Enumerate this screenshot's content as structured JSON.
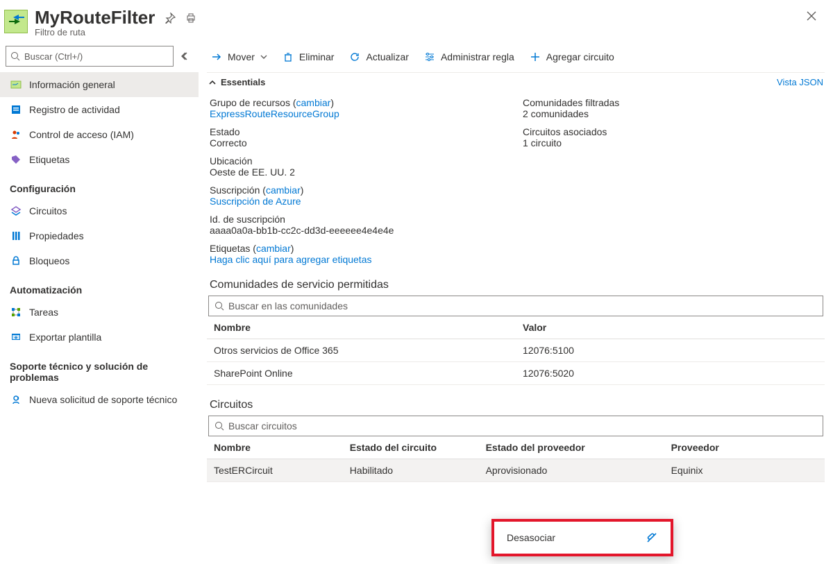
{
  "header": {
    "title": "MyRouteFilter",
    "subtitle": "Filtro de ruta"
  },
  "sidebar": {
    "search_placeholder": "Buscar (Ctrl+/)",
    "sections": {
      "top": [
        {
          "label": "Información general",
          "icon": "routefilter",
          "selected": true
        },
        {
          "label": "Registro de actividad",
          "icon": "activity"
        },
        {
          "label": "Control de acceso (IAM)",
          "icon": "iam"
        },
        {
          "label": "Etiquetas",
          "icon": "tag"
        }
      ],
      "config_title": "Configuración",
      "config": [
        {
          "label": "Circuitos",
          "icon": "circuits"
        },
        {
          "label": "Propiedades",
          "icon": "properties"
        },
        {
          "label": "Bloqueos",
          "icon": "lock"
        }
      ],
      "auto_title": "Automatización",
      "auto": [
        {
          "label": "Tareas",
          "icon": "tasks"
        },
        {
          "label": "Exportar plantilla",
          "icon": "export"
        }
      ],
      "support_title": "Soporte técnico y solución de problemas",
      "support": [
        {
          "label": "Nueva solicitud de soporte técnico",
          "icon": "support"
        }
      ]
    }
  },
  "toolbar": {
    "move": "Mover",
    "delete": "Eliminar",
    "refresh": "Actualizar",
    "manage_rule": "Administrar regla",
    "add_circuit": "Agregar circuito"
  },
  "essentials": {
    "toggle_label": "Essentials",
    "json_view": "Vista JSON",
    "rg_label": "Grupo de recursos",
    "change": "cambiar",
    "rg_value": "ExpressRouteResourceGroup",
    "state_label": "Estado",
    "state_value": "Correcto",
    "location_label": "Ubicación",
    "location_value": "Oeste de EE. UU. 2",
    "sub_label": "Suscripción",
    "sub_value": "Suscripción de Azure",
    "subid_label": "Id. de suscripción",
    "subid_value": "aaaa0a0a-bb1b-cc2c-dd3d-eeeeee4e4e4e",
    "tags_label": "Etiquetas",
    "tags_value": "Haga clic aquí para agregar etiquetas",
    "communities_label": "Comunidades filtradas",
    "communities_value": "2 comunidades",
    "circuits_label": "Circuitos asociados",
    "circuits_value": "1 circuito"
  },
  "communities": {
    "title": "Comunidades de servicio permitidas",
    "search_placeholder": "Buscar en las comunidades",
    "col_name": "Nombre",
    "col_value": "Valor",
    "rows": [
      {
        "name": "Otros servicios de Office 365",
        "value": "12076:5100"
      },
      {
        "name": "SharePoint Online",
        "value": "12076:5020"
      }
    ]
  },
  "circuits": {
    "title": "Circuitos",
    "search_placeholder": "Buscar circuitos",
    "col_name": "Nombre",
    "col_circuit_state": "Estado del circuito",
    "col_provider_state": "Estado del proveedor",
    "col_provider": "Proveedor",
    "rows": [
      {
        "name": "TestERCircuit",
        "circuit_state": "Habilitado",
        "provider_state": "Aprovisionado",
        "provider": "Equinix"
      }
    ]
  },
  "context_menu": {
    "dissociate": "Desasociar"
  }
}
